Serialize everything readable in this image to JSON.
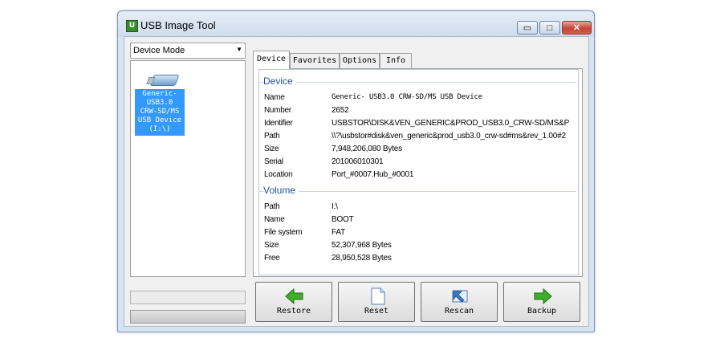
{
  "window": {
    "title": "USB Image Tool",
    "min_glyph": "▭",
    "max_glyph": "□",
    "close_glyph": "✕"
  },
  "app_icon_letter": "U",
  "mode_select": {
    "value": "Device Mode",
    "arrow": "▼"
  },
  "device_list": {
    "selected": [
      "Generic-",
      "USB3.0",
      "CRW-SD/MS",
      "USB Device",
      "(I:\\)"
    ]
  },
  "tabs": [
    {
      "label": "Device"
    },
    {
      "label": "Favorites"
    },
    {
      "label": "Options"
    },
    {
      "label": "Info"
    }
  ],
  "device_group": {
    "title": "Device",
    "rows": [
      {
        "label": "Name",
        "value": "Generic- USB3.0 CRW-SD/MS USB Device"
      },
      {
        "label": "Number",
        "value": "2652"
      },
      {
        "label": "Identifier",
        "value": "USBSTOR\\DISK&VEN_GENERIC&PROD_USB3.0_CRW-SD/MS&P"
      },
      {
        "label": "Path",
        "value": "\\\\?\\usbstor#disk&ven_generic&prod_usb3.0_crw-sd#ms&rev_1.00#2"
      },
      {
        "label": "Size",
        "value": "7,948,206,080 Bytes"
      },
      {
        "label": "Serial",
        "value": "201006010301"
      },
      {
        "label": "Location",
        "value": "Port_#0007.Hub_#0001"
      }
    ]
  },
  "volume_group": {
    "title": "Volume",
    "rows": [
      {
        "label": "Path",
        "value": "I:\\"
      },
      {
        "label": "Name",
        "value": "BOOT"
      },
      {
        "label": "File system",
        "value": "FAT"
      },
      {
        "label": "Size",
        "value": "52,307,968 Bytes"
      },
      {
        "label": "Free",
        "value": "28,950,528 Bytes"
      }
    ]
  },
  "buttons": {
    "restore": "Restore",
    "reset": "Reset",
    "rescan": "Rescan",
    "backup": "Backup"
  },
  "colors": {
    "selection": "#3399ff",
    "group_title": "#1e50a0",
    "arrow_green": "#3fae2a"
  }
}
